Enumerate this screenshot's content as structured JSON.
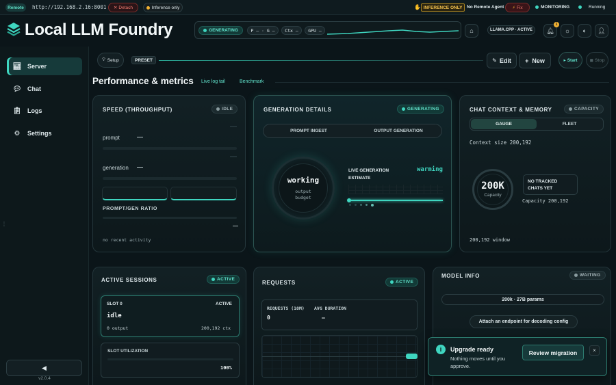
{
  "topbar": {
    "mode": "Remote",
    "url": "http://192.168.2.16:8001",
    "detach": "Detach",
    "inference_only": "Inference only",
    "inference_only_badge": "INFERENCE ONLY",
    "no_remote_agent": "No Remote Agent",
    "fix": "Fix",
    "monitoring": "MONITORING",
    "running": "Running"
  },
  "header": {
    "app_title": "Local LLM Foundry",
    "generating": "GENERATING",
    "p_metric": "P — · G —",
    "ctx_metric": "Ctx —",
    "gpu_metric": "GPU —",
    "backend_status": "LLAMA.CPP · ACTIVE",
    "notification_count": "1"
  },
  "sidebar": {
    "items": [
      {
        "label": "Server",
        "icon": "chart-icon"
      },
      {
        "label": "Chat",
        "icon": "chat-icon"
      },
      {
        "label": "Logs",
        "icon": "clipboard-icon"
      },
      {
        "label": "Settings",
        "icon": "gear-icon"
      }
    ],
    "collapse_icon": "◀",
    "version": "v2.0.4"
  },
  "toolbar": {
    "setup": "Setup",
    "preset": "PRESET",
    "edit": "Edit",
    "new": "New",
    "start": "Start",
    "stop": "Stop"
  },
  "section": {
    "title": "Performance & metrics",
    "tabs": [
      "Live log tail",
      "Benchmark"
    ]
  },
  "speed": {
    "title": "SPEED (THROUGHPUT)",
    "badge": "IDLE",
    "prompt_label": "prompt",
    "prompt_value": "—",
    "generation_label": "generation",
    "generation_value": "—",
    "ratio_label": "PROMPT/GEN RATIO",
    "ratio_value": "—",
    "footer": "no recent activity"
  },
  "generation": {
    "title": "GENERATION DETAILS",
    "badge": "GENERATING",
    "tabs": [
      "PROMPT INGEST",
      "OUTPUT GENERATION"
    ],
    "ring_main": "working",
    "ring_sub": "output budget",
    "estimate_label": "LIVE GENERATION ESTIMATE",
    "estimate_value": "warming"
  },
  "context": {
    "title": "CHAT CONTEXT & MEMORY",
    "badge": "CAPACITY",
    "tabs": [
      "GAUGE",
      "FLEET"
    ],
    "context_size": "Context size 200,192",
    "gauge_value": "200K",
    "gauge_label": "Capacity",
    "capacity": "Capacity 200,192",
    "no_chats": "NO TRACKED CHATS YET",
    "window": "200,192 window"
  },
  "sessions": {
    "title": "ACTIVE SESSIONS",
    "badge": "ACTIVE",
    "slot_name": "SLOT 0",
    "slot_status": "ACTIVE",
    "slot_state": "idle",
    "slot_output": "0 output",
    "slot_ctx": "200,192 ctx",
    "util_label": "SLOT UTILIZATION",
    "util_value": "100%",
    "util_fraction": 1.0
  },
  "requests": {
    "title": "REQUESTS",
    "badge": "ACTIVE",
    "count_label": "REQUESTS (10M)",
    "count_value": "0",
    "avg_label": "AVG DURATION",
    "avg_value": "—"
  },
  "model": {
    "title": "MODEL INFO",
    "badge": "WAITING",
    "params": "200k · 27B params",
    "attach": "Attach an endpoint for decoding config"
  },
  "toast": {
    "title": "Upgrade ready",
    "body": "Nothing moves until you approve.",
    "action": "Review migration",
    "close": "×"
  },
  "colors": {
    "accent": "#3fd6c0",
    "background": "#0b1519",
    "panel": "#122024",
    "danger": "#e05a4f",
    "warning": "#f2b233"
  }
}
